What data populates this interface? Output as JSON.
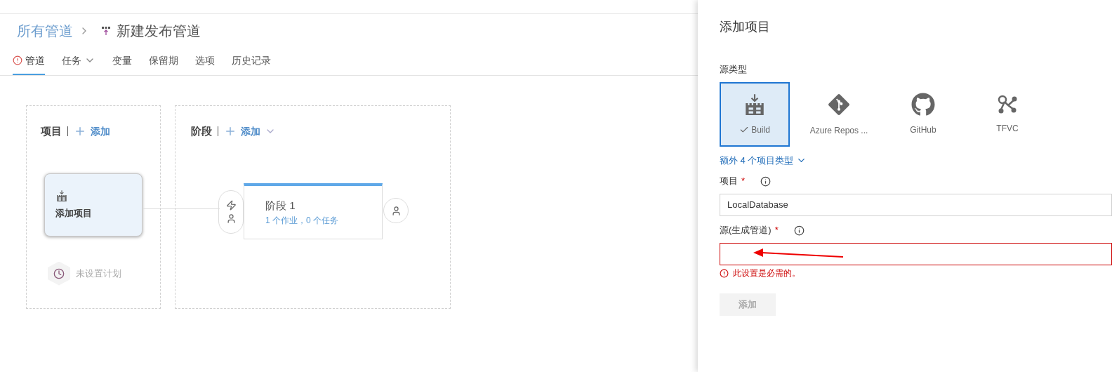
{
  "header": {
    "parent": "所有管道",
    "current": "新建发布管道"
  },
  "tabs": [
    {
      "label": "管道",
      "selected": true,
      "warning": true,
      "has_menu": false
    },
    {
      "label": "任务",
      "selected": false,
      "warning": false,
      "has_menu": true
    },
    {
      "label": "变量",
      "selected": false,
      "warning": false,
      "has_menu": false
    },
    {
      "label": "保留期",
      "selected": false,
      "warning": false,
      "has_menu": false
    },
    {
      "label": "选项",
      "selected": false,
      "warning": false,
      "has_menu": false
    },
    {
      "label": "历史记录",
      "selected": false,
      "warning": false,
      "has_menu": false
    }
  ],
  "artifacts": {
    "title": "项目",
    "add": "添加",
    "card": "添加项目",
    "schedule": "未设置计划"
  },
  "stages": {
    "title": "阶段",
    "add": "添加",
    "stage": {
      "name": "阶段 1",
      "summary": "1 个作业，0 个任务"
    }
  },
  "panel": {
    "title": "添加项目",
    "source_type_label": "源类型",
    "source_types": [
      {
        "label": "Build",
        "kind": "build",
        "selected": true
      },
      {
        "label": "Azure Repos ...",
        "kind": "git",
        "selected": false
      },
      {
        "label": "GitHub",
        "kind": "github",
        "selected": false
      },
      {
        "label": "TFVC",
        "kind": "tfvc",
        "selected": false
      }
    ],
    "more_types": "额外 4 个项目类型",
    "fields": [
      {
        "label": "项目",
        "required_mark": "*",
        "value": "LocalDatabase",
        "invalid": false
      },
      {
        "label": "源(生成管道)",
        "required_mark": "*",
        "invalid": true,
        "error": "此设置是必需的。"
      }
    ],
    "button": {
      "label": "添加",
      "disabled": true
    }
  }
}
